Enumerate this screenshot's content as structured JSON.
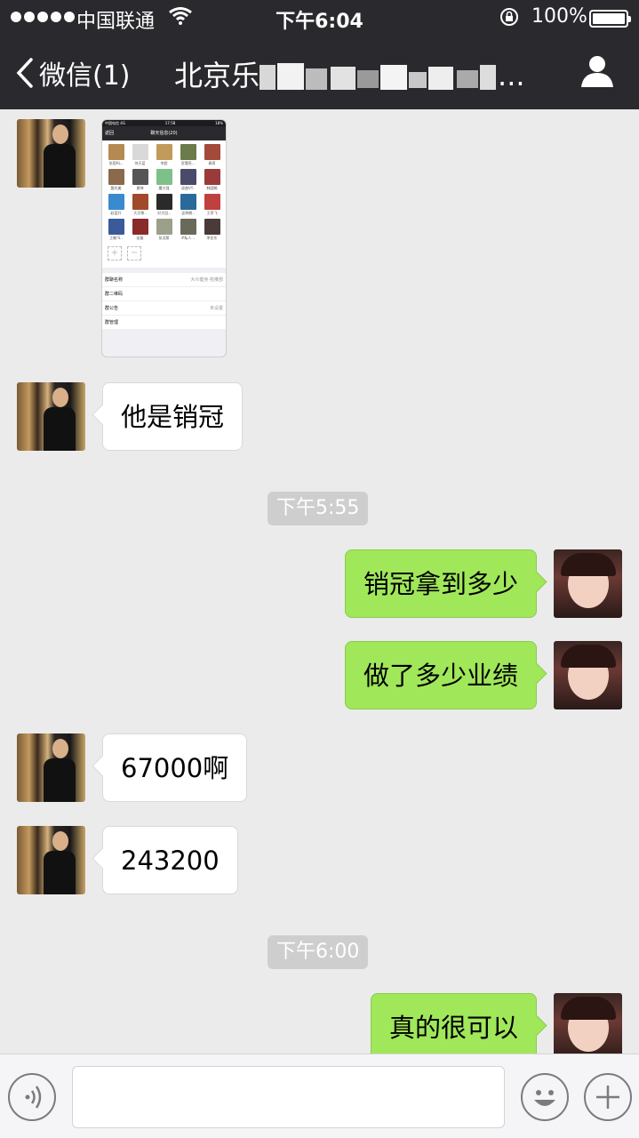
{
  "status_bar": {
    "carrier": "中国联通",
    "time": "下午6:04",
    "battery": "100%"
  },
  "nav": {
    "back_label": "微信(1)",
    "title_visible": "北京乐",
    "title_suffix": "..."
  },
  "colors": {
    "topbar": "#2a2a2e",
    "chat_bg": "#ebebeb",
    "out_bubble": "#a0e75a",
    "in_bubble": "#ffffff"
  },
  "image_message": {
    "nav_title": "聊天信息(20)",
    "nav_back": "返回",
    "status_carrier": "中国电信 4G",
    "status_time": "17:58",
    "status_battery": "18%",
    "members": [
      {
        "name": "张国AL..",
        "color": "#b58a52"
      },
      {
        "name": "何天蓝",
        "color": "#d9d9d9"
      },
      {
        "name": "李超",
        "color": "#c29a5a"
      },
      {
        "name": "亚懂亮...",
        "color": "#6b7b4a"
      },
      {
        "name": "春哥",
        "color": "#a34a3a"
      },
      {
        "name": "娶先美",
        "color": "#8a6a4a"
      },
      {
        "name": "黄坤",
        "color": "#555555"
      },
      {
        "name": "魔大强",
        "color": "#7fc08a"
      },
      {
        "name": "虎曲VY..",
        "color": "#4a4a6a"
      },
      {
        "name": "韩国赐",
        "color": "#9a3a3a"
      },
      {
        "name": "赵蓝升",
        "color": "#3a8ad0"
      },
      {
        "name": "大贝黎..",
        "color": "#a04a2a"
      },
      {
        "name": "好大回..",
        "color": "#2a2a2a"
      },
      {
        "name": "这称期..",
        "color": "#2a6a9a"
      },
      {
        "name": "王菲飞",
        "color": "#c04040"
      },
      {
        "name": "王敏!S..",
        "color": "#3a5a9a"
      },
      {
        "name": "宏磊",
        "color": "#8a2a2a"
      },
      {
        "name": "张泷第",
        "color": "#9aa08a"
      },
      {
        "name": "#私人...",
        "color": "#6a6a5a"
      },
      {
        "name": "李亚东",
        "color": "#4a3a3a"
      }
    ],
    "rows": [
      {
        "label": "群聊名称",
        "value": "大众健身·拓推部"
      },
      {
        "label": "群二维码",
        "value": ""
      },
      {
        "label": "群公告",
        "value": "未设置"
      },
      {
        "label": "群管理",
        "value": ""
      }
    ]
  },
  "messages": [
    {
      "id": "m1",
      "text": "他是销冠"
    },
    {
      "id": "t1",
      "text": "下午5:55"
    },
    {
      "id": "m2",
      "text": "销冠拿到多少"
    },
    {
      "id": "m3",
      "text": "做了多少业绩"
    },
    {
      "id": "m4",
      "text": "67000啊"
    },
    {
      "id": "m5",
      "text": "243200"
    },
    {
      "id": "t2",
      "text": "下午6:00"
    },
    {
      "id": "m6",
      "text": "真的很可以"
    }
  ],
  "input": {
    "value": ""
  }
}
